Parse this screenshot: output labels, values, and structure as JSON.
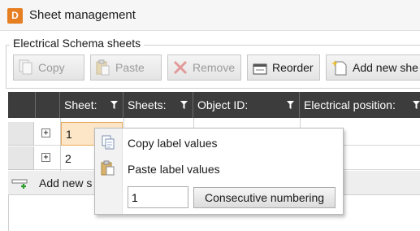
{
  "window": {
    "app_icon_letter": "D",
    "title": "Sheet management"
  },
  "group": {
    "label": "Electrical Schema sheets"
  },
  "toolbar": {
    "copy_label": "Copy",
    "paste_label": "Paste",
    "remove_label": "Remove",
    "reorder_label": "Reorder",
    "add_new_sheet_label": "Add new she"
  },
  "grid": {
    "columns": [
      "Sheet:",
      "Sheets:",
      "Object ID:",
      "Electrical position:"
    ],
    "rows": [
      {
        "sheet": "1",
        "expander": "+"
      },
      {
        "sheet": "2",
        "expander": "+"
      }
    ],
    "add_new_label": "Add new s"
  },
  "context_menu": {
    "copy_label": "Copy label values",
    "paste_label": "Paste label values",
    "number_value": "1",
    "consecutive_label": "Consecutive numbering"
  }
}
